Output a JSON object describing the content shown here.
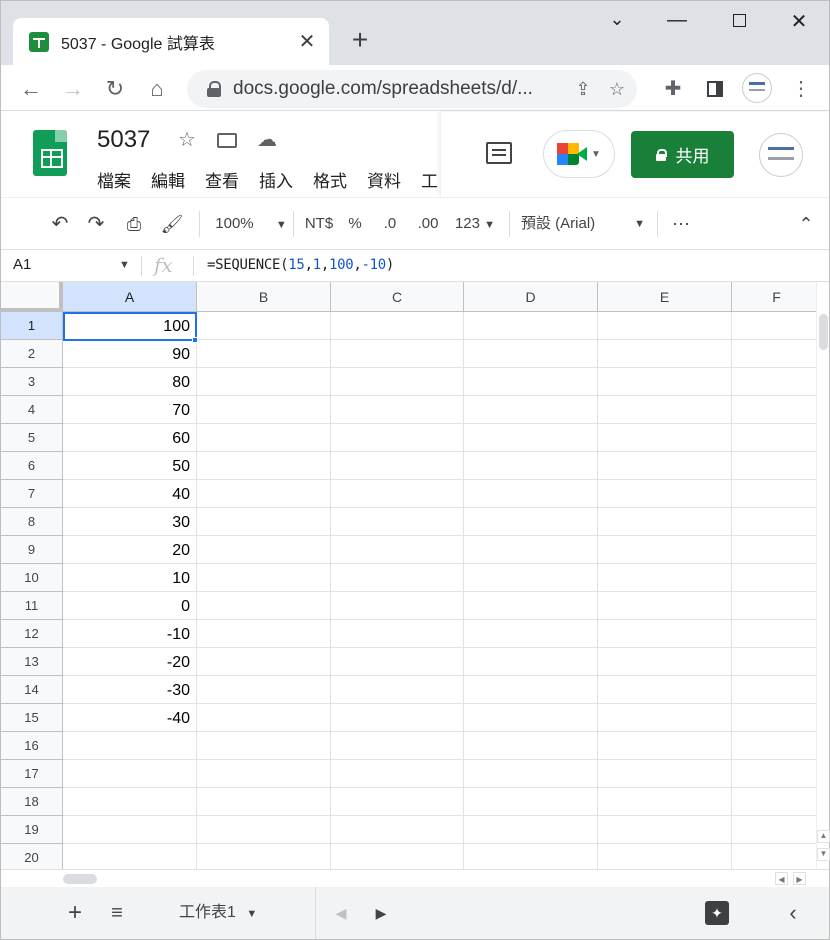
{
  "browser": {
    "tab_title": "5037 - Google 試算表",
    "url": "docs.google.com/spreadsheets/d/...",
    "window_controls": [
      "chevron-down-icon",
      "minimize-icon",
      "maximize-icon",
      "close-icon"
    ]
  },
  "doc": {
    "title": "5037",
    "menu": [
      "檔案",
      "編輯",
      "查看",
      "插入",
      "格式",
      "資料",
      "工"
    ],
    "share_label": "共用"
  },
  "toolbar": {
    "zoom": "100%",
    "currency": "NT$",
    "percent": "%",
    "dec_less": ".0",
    "dec_more": ".00",
    "number_format": "123",
    "font": "預設 (Arial)",
    "more": "⋯"
  },
  "formula_bar": {
    "name_box": "A1",
    "fx": "fx",
    "formula_prefix": "=SEQUENCE(",
    "arg1": "15",
    "sep1": ",",
    "arg2": "1",
    "sep2": ",",
    "arg3": "100",
    "sep3": ",",
    "arg4": "-10",
    "formula_suffix": ")"
  },
  "grid": {
    "columns": [
      "A",
      "B",
      "C",
      "D",
      "E",
      "F"
    ],
    "rows": [
      "1",
      "2",
      "3",
      "4",
      "5",
      "6",
      "7",
      "8",
      "9",
      "10",
      "11",
      "12",
      "13",
      "14",
      "15",
      "16",
      "17",
      "18",
      "19",
      "20"
    ],
    "column_a_values": [
      "100",
      "90",
      "80",
      "70",
      "60",
      "50",
      "40",
      "30",
      "20",
      "10",
      "0",
      "-10",
      "-20",
      "-30",
      "-40",
      "",
      "",
      "",
      "",
      ""
    ],
    "active_cell": "A1"
  },
  "sheets": {
    "tab_label": "工作表1"
  },
  "colors": {
    "share_green": "#188038",
    "sheets_green": "#0f9d58",
    "selection_blue": "#1a73e8",
    "formula_number_blue": "#1155cc"
  }
}
